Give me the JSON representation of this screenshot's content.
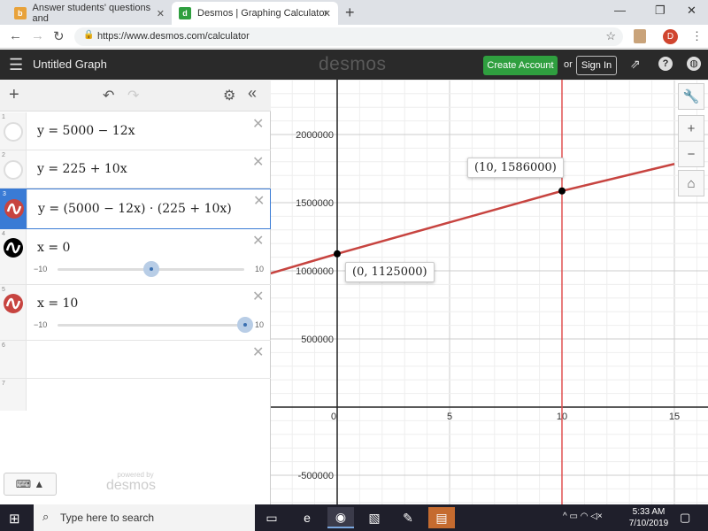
{
  "browser": {
    "tabs": [
      {
        "title": "Answer students' questions and",
        "active": false
      },
      {
        "title": "Desmos | Graphing Calculator",
        "active": true
      }
    ],
    "url": "https://www.desmos.com/calculator",
    "profile_initial": "D"
  },
  "header": {
    "title": "Untitled Graph",
    "logo": "desmos",
    "create_account": "Create Account",
    "or": "or",
    "sign_in": "Sign In"
  },
  "expressions": [
    {
      "num": "1",
      "text": "y = 5000 − 12x",
      "icon": "empty"
    },
    {
      "num": "2",
      "text": "y = 225 + 10x",
      "icon": "empty"
    },
    {
      "num": "3",
      "text": "y = (5000 − 12x) · (225 + 10x)",
      "icon": "red"
    },
    {
      "num": "4",
      "text": "x = 0",
      "icon": "black",
      "slider": {
        "min": "−10",
        "max": "10",
        "value": 0
      }
    },
    {
      "num": "5",
      "text": "x = 10",
      "icon": "red",
      "slider": {
        "min": "−10",
        "max": "10",
        "value": 10
      }
    },
    {
      "num": "6",
      "text": "",
      "icon": "none"
    },
    {
      "num": "7",
      "text": "",
      "icon": "none"
    }
  ],
  "footer": {
    "powered_by": "powered by",
    "logo": "desmos"
  },
  "graph": {
    "x_ticks": [
      "0",
      "5",
      "10",
      "15"
    ],
    "y_ticks": [
      "2000000",
      "1500000",
      "1000000",
      "500000",
      "-500000"
    ],
    "point_labels": [
      "(0, 1125000)",
      "(10, 1586000)"
    ],
    "curve_color": "#c74440",
    "vline_color": "#e05050"
  },
  "chart_data": {
    "type": "line",
    "series": [
      {
        "values_x": [
          -4,
          0,
          10,
          15
        ],
        "values_y": [
          931200,
          1125000,
          1586000,
          1784000
        ]
      }
    ],
    "points": [
      {
        "x": 0,
        "y": 1125000,
        "label": "(0, 1125000)"
      },
      {
        "x": 10,
        "y": 1586000,
        "label": "(10, 1586000)"
      }
    ],
    "vertical_lines": [
      10
    ],
    "xlim": [
      -5.5,
      16.5
    ],
    "ylim": [
      -700000,
      2400000
    ],
    "grid": true
  },
  "taskbar": {
    "search_placeholder": "Type here to search",
    "time": "5:33 AM",
    "date": "7/10/2019"
  }
}
